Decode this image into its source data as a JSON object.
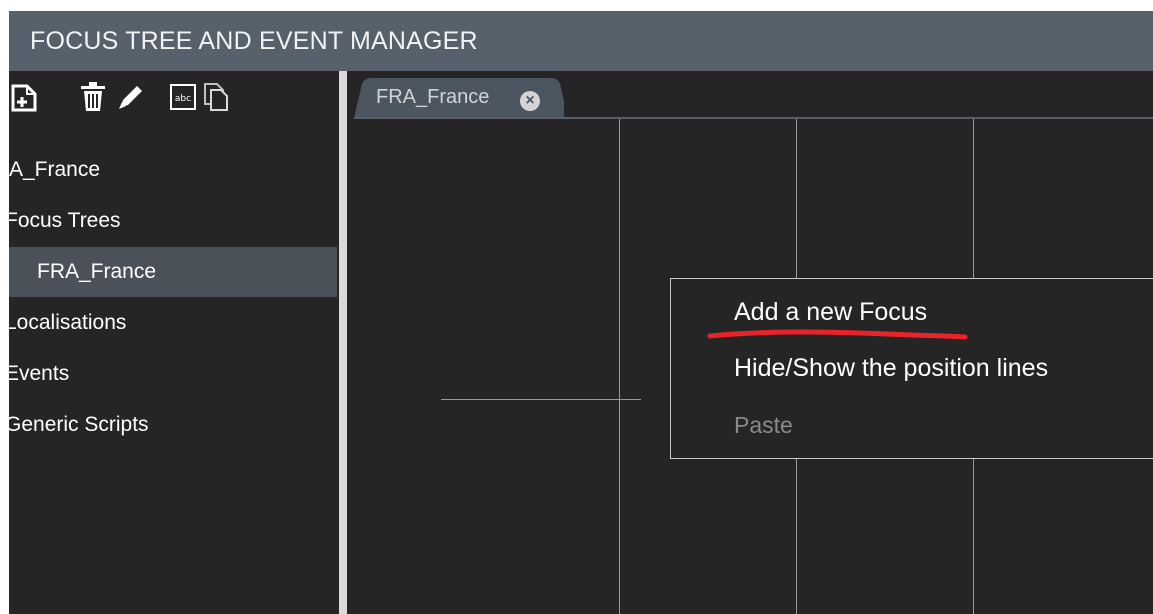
{
  "app": {
    "title": "FOCUS TREE AND EVENT MANAGER"
  },
  "toolbar": {
    "icons": [
      "add-file-icon",
      "trash-icon",
      "pencil-icon",
      "rename-icon",
      "copy-icon"
    ]
  },
  "sidebar": {
    "items": [
      {
        "label": "A_France",
        "selected": false
      },
      {
        "label": "Focus Trees",
        "selected": false
      },
      {
        "label": "FRA_France",
        "selected": true
      },
      {
        "label": "Localisations",
        "selected": false
      },
      {
        "label": "Events",
        "selected": false
      },
      {
        "label": "Generic Scripts",
        "selected": false
      }
    ]
  },
  "editor": {
    "tab": {
      "label": "FRA_France",
      "close_glyph": "×"
    }
  },
  "context_menu": {
    "items": [
      {
        "label": "Add a new Focus",
        "enabled": true,
        "highlighted_by_annotation": true
      },
      {
        "label": "Hide/Show the position lines",
        "enabled": true
      },
      {
        "label": "Paste",
        "enabled": false
      }
    ],
    "annotation_color": "#e8232a"
  },
  "colors": {
    "title_bar": "#56616c",
    "background": "#252526",
    "selected_item": "#4a5159",
    "tab": "#4c5661",
    "annotation": "#e8232a"
  }
}
